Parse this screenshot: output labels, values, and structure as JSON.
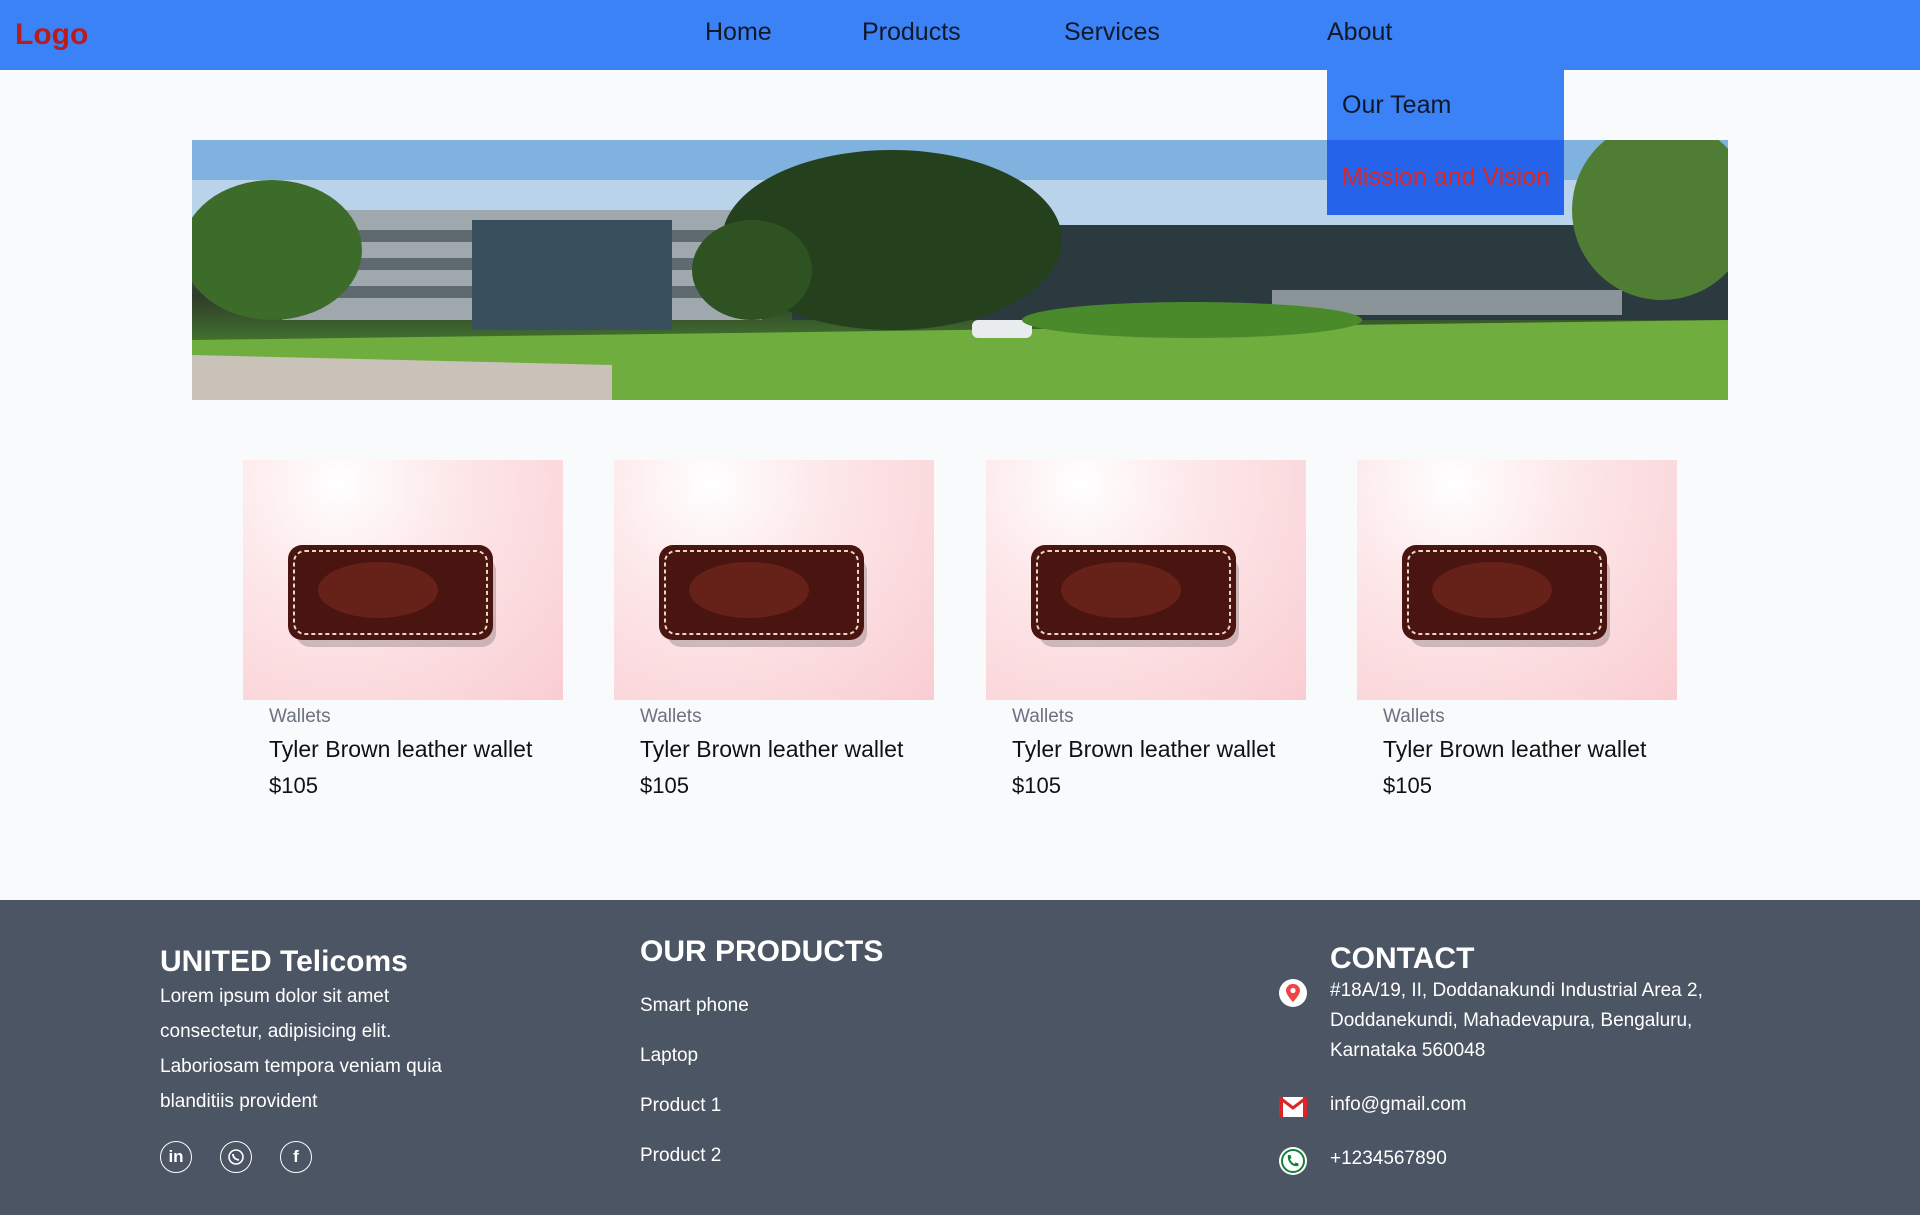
{
  "navbar": {
    "logo": "Logo",
    "links": [
      "Home",
      "Products",
      "Services",
      "About"
    ],
    "dropdown": [
      "Our Team",
      "Mission and Vision"
    ]
  },
  "products": [
    {
      "category": "Wallets",
      "title": "Tyler Brown leather wallet",
      "price": "$105"
    },
    {
      "category": "Wallets",
      "title": "Tyler Brown leather wallet",
      "price": "$105"
    },
    {
      "category": "Wallets",
      "title": "Tyler Brown leather wallet",
      "price": "$105"
    },
    {
      "category": "Wallets",
      "title": "Tyler Brown leather wallet",
      "price": "$105"
    }
  ],
  "footer": {
    "about": {
      "heading": "UNITED Telicoms",
      "text_lines": [
        "Lorem ipsum dolor sit amet",
        "consectetur, adipisicing elit.",
        "Laboriosam tempora veniam quia",
        "blanditiis provident"
      ],
      "socials": [
        "linkedin-icon",
        "whatsapp-icon",
        "facebook-icon"
      ]
    },
    "products": {
      "heading": "OUR PRODUCTS",
      "items": [
        "Smart phone",
        "Laptop",
        "Product 1",
        "Product 2"
      ]
    },
    "contact": {
      "heading": "CONTACT",
      "address_lines": [
        "#18A/19, II, Doddanakundi Industrial Area 2,",
        "Doddanekundi, Mahadevapura, Bengaluru,",
        "Karnataka 560048"
      ],
      "email": "info@gmail.com",
      "phone": "+1234567890"
    }
  },
  "colors": {
    "navbar": "#3b82f6",
    "logo": "#b91c1c",
    "footer": "#4b5563",
    "dropdown_active_text": "#dc2626"
  }
}
